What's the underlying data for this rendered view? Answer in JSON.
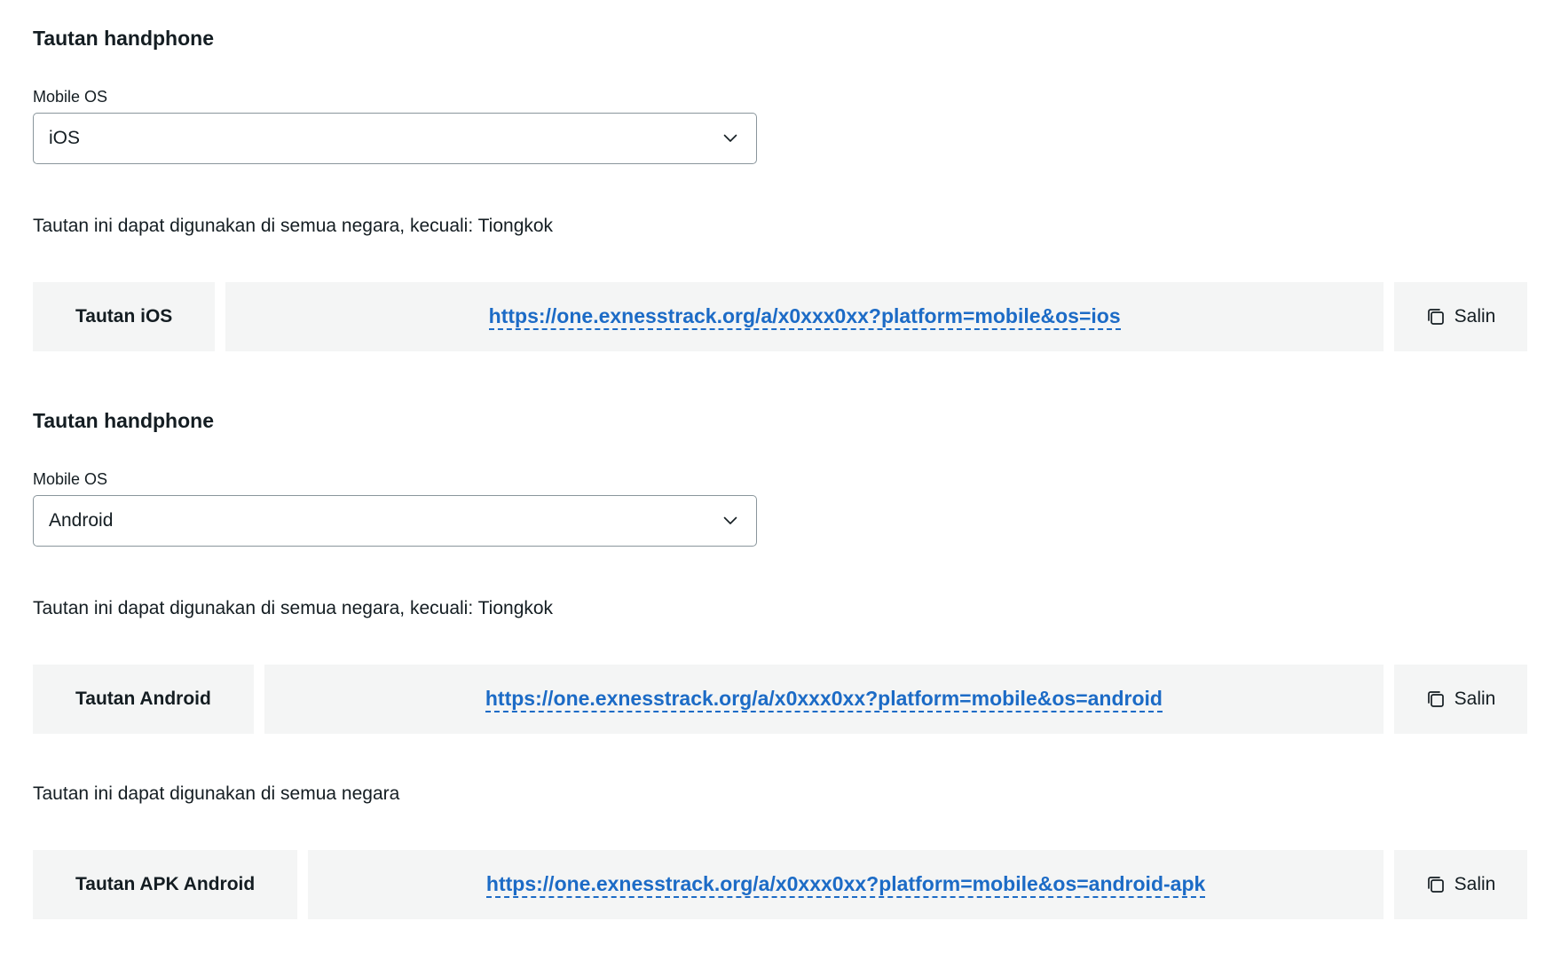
{
  "sections": [
    {
      "heading": "Tautan handphone",
      "os_label": "Mobile OS",
      "os_value": "iOS",
      "notes": [
        {
          "text": "Tautan ini dapat digunakan di semua negara, kecuali: Tiongkok",
          "link_label": "Tautan iOS",
          "url": "https://one.exnesstrack.org/a/x0xxx0xx?platform=mobile&os=ios",
          "copy_label": "Salin"
        }
      ]
    },
    {
      "heading": "Tautan handphone",
      "os_label": "Mobile OS",
      "os_value": "Android",
      "notes": [
        {
          "text": "Tautan ini dapat digunakan di semua negara, kecuali: Tiongkok",
          "link_label": "Tautan Android",
          "url": "https://one.exnesstrack.org/a/x0xxx0xx?platform=mobile&os=android",
          "copy_label": "Salin"
        },
        {
          "text": "Tautan ini dapat digunakan di semua negara",
          "link_label": "Tautan APK Android",
          "url": "https://one.exnesstrack.org/a/x0xxx0xx?platform=mobile&os=android-apk",
          "copy_label": "Salin"
        }
      ]
    }
  ],
  "icons": {
    "dropdown": "chevron-down-icon",
    "copy": "copy-icon"
  },
  "colors": {
    "link": "#1c6bc6",
    "cell_background": "#f4f5f5",
    "text": "#141d22",
    "select_border": "#8a969c"
  }
}
